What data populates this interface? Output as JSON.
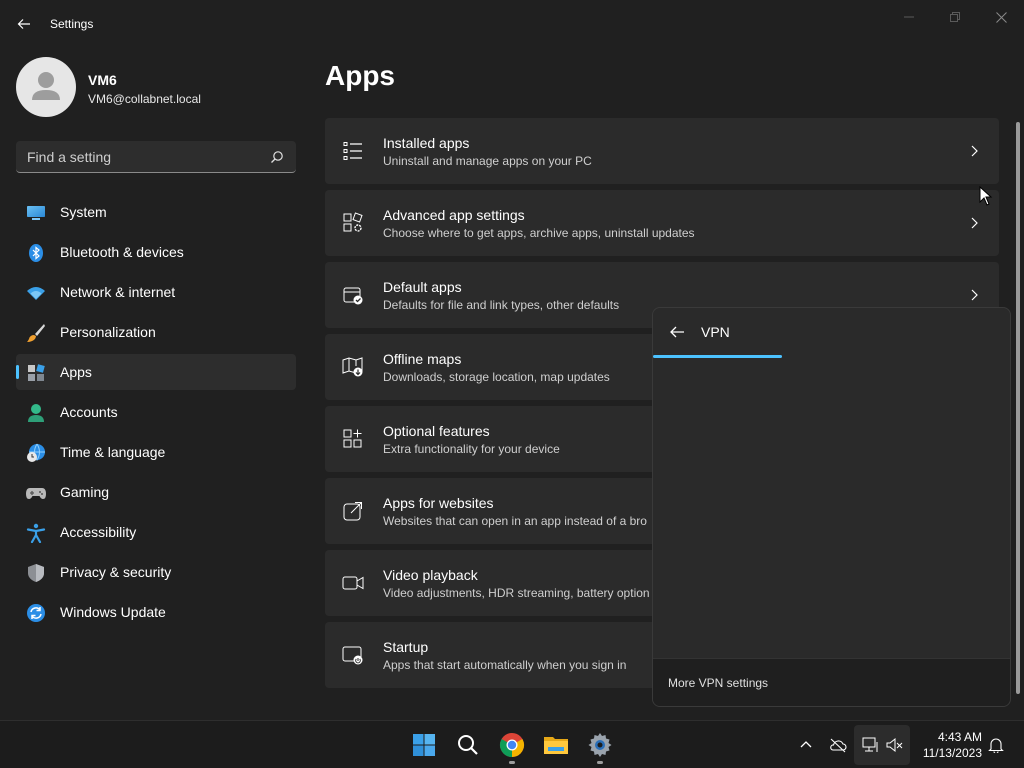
{
  "window": {
    "title": "Settings"
  },
  "user": {
    "name": "VM6",
    "email": "VM6@collabnet.local"
  },
  "search": {
    "placeholder": "Find a setting"
  },
  "sidebar": {
    "items": [
      {
        "label": "System",
        "icon": "system-icon"
      },
      {
        "label": "Bluetooth & devices",
        "icon": "bluetooth-icon"
      },
      {
        "label": "Network & internet",
        "icon": "wifi-icon"
      },
      {
        "label": "Personalization",
        "icon": "brush-icon"
      },
      {
        "label": "Apps",
        "icon": "apps-icon",
        "active": true
      },
      {
        "label": "Accounts",
        "icon": "accounts-icon"
      },
      {
        "label": "Time & language",
        "icon": "globe-clock-icon"
      },
      {
        "label": "Gaming",
        "icon": "gamepad-icon"
      },
      {
        "label": "Accessibility",
        "icon": "accessibility-icon"
      },
      {
        "label": "Privacy & security",
        "icon": "shield-icon"
      },
      {
        "label": "Windows Update",
        "icon": "update-icon"
      }
    ]
  },
  "page": {
    "title": "Apps"
  },
  "cards": [
    {
      "title": "Installed apps",
      "desc": "Uninstall and manage apps on your PC",
      "icon": "list-icon"
    },
    {
      "title": "Advanced app settings",
      "desc": "Choose where to get apps, archive apps, uninstall updates",
      "icon": "app-settings-icon"
    },
    {
      "title": "Default apps",
      "desc": "Defaults for file and link types, other defaults",
      "icon": "default-apps-icon"
    },
    {
      "title": "Offline maps",
      "desc": "Downloads, storage location, map updates",
      "icon": "map-icon"
    },
    {
      "title": "Optional features",
      "desc": "Extra functionality for your device",
      "icon": "optional-features-icon"
    },
    {
      "title": "Apps for websites",
      "desc": "Websites that can open in an app instead of a bro",
      "icon": "open-external-icon"
    },
    {
      "title": "Video playback",
      "desc": "Video adjustments, HDR streaming, battery option",
      "icon": "video-icon"
    },
    {
      "title": "Startup",
      "desc": "Apps that start automatically when you sign in",
      "icon": "startup-icon"
    }
  ],
  "vpn_flyout": {
    "title": "VPN",
    "more_link": "More VPN settings",
    "progress": 0.36
  },
  "taskbar": {
    "apps": [
      "windows-start-icon",
      "search-icon",
      "chrome-icon",
      "file-explorer-icon",
      "settings-icon"
    ],
    "time": "4:43 AM",
    "date": "11/13/2023"
  },
  "colors": {
    "background": "#202020",
    "card": "#2b2b2b",
    "accent": "#4cc2ff",
    "taskbar": "#1c1c1c"
  }
}
